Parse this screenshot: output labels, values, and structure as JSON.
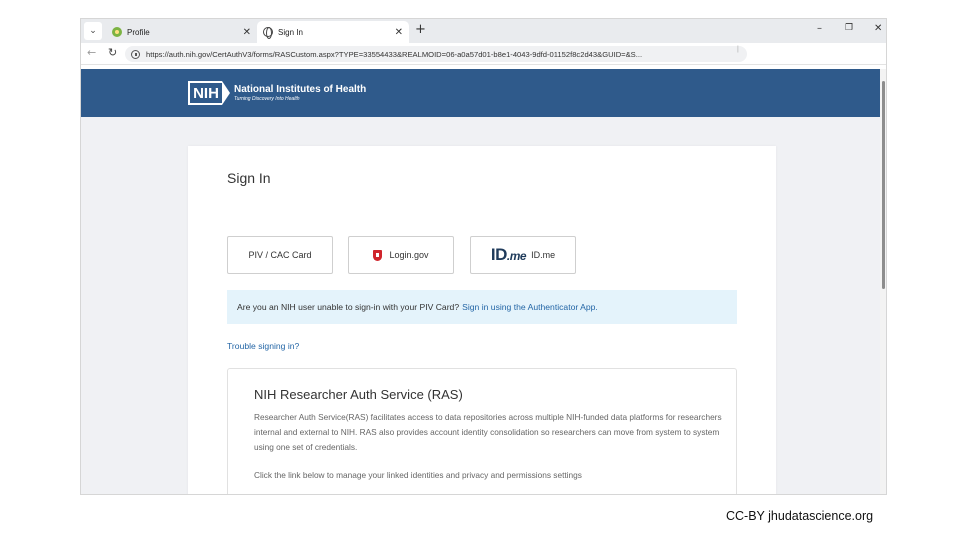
{
  "browser": {
    "tabs": [
      {
        "label": "Profile",
        "active": false
      },
      {
        "label": "Sign In",
        "active": true
      }
    ],
    "url": "https://auth.nih.gov/CertAuthV3/forms/RASCustom.aspx?TYPE=33554433&REALMOID=06-a0a57d01-b8e1-4043-9dfd-01152f8c2d43&GUID=&S..."
  },
  "header": {
    "logo_abbr": "NIH",
    "org_name": "National Institutes of Health",
    "tagline": "Turning Discovery Into Health",
    "bg_color": "#2f5a8b"
  },
  "signin": {
    "title": "Sign In",
    "methods": {
      "piv": "PIV / CAC Card",
      "login_gov": "Login.gov",
      "idme_logo": "ID",
      "idme_logo_suffix": ".me",
      "idme": "ID.me"
    },
    "info_text": "Are you an NIH user unable to sign-in with your PIV Card?",
    "info_link": "Sign in using the Authenticator App.",
    "trouble": "Trouble signing in?"
  },
  "ras": {
    "title": "NIH Researcher Auth Service (RAS)",
    "description": "Researcher Auth Service(RAS) facilitates access to data repositories across multiple NIH-funded data platforms for researchers internal and external to NIH. RAS also provides account identity consolidation so researchers can move from system to system using one set of credentials.",
    "link_prompt": "Click the link below to manage your linked identities and privacy and permissions settings"
  },
  "credit": "CC-BY  jhudatascience.org"
}
